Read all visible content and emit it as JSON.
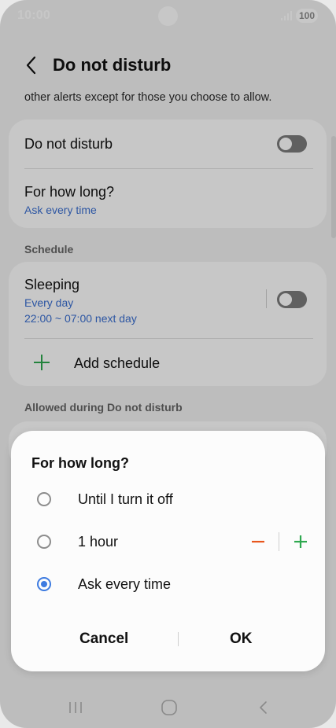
{
  "status_bar": {
    "time": "10:00",
    "battery": "100"
  },
  "header": {
    "title": "Do not disturb",
    "description": "other alerts except for those you choose to allow."
  },
  "dnd_card": {
    "dnd_label": "Do not disturb",
    "dnd_enabled": false,
    "duration_label": "For how long?",
    "duration_value": "Ask every time"
  },
  "schedule": {
    "section_label": "Schedule",
    "item_title": "Sleeping",
    "item_days": "Every day",
    "item_time": "22:00 ~ 07:00 next day",
    "item_enabled": false,
    "add_label": "Add schedule"
  },
  "allowed": {
    "section_label": "Allowed during Do not disturb"
  },
  "dialog": {
    "title": "For how long?",
    "options": [
      {
        "label": "Until I turn it off",
        "selected": false
      },
      {
        "label": "1 hour",
        "selected": false
      },
      {
        "label": "Ask every time",
        "selected": true
      }
    ],
    "cancel_label": "Cancel",
    "ok_label": "OK"
  },
  "colors": {
    "accent_blue": "#3d7be0",
    "link_blue": "#3a6fd1",
    "minus_orange": "#e8561c",
    "plus_green": "#2ea84f"
  }
}
